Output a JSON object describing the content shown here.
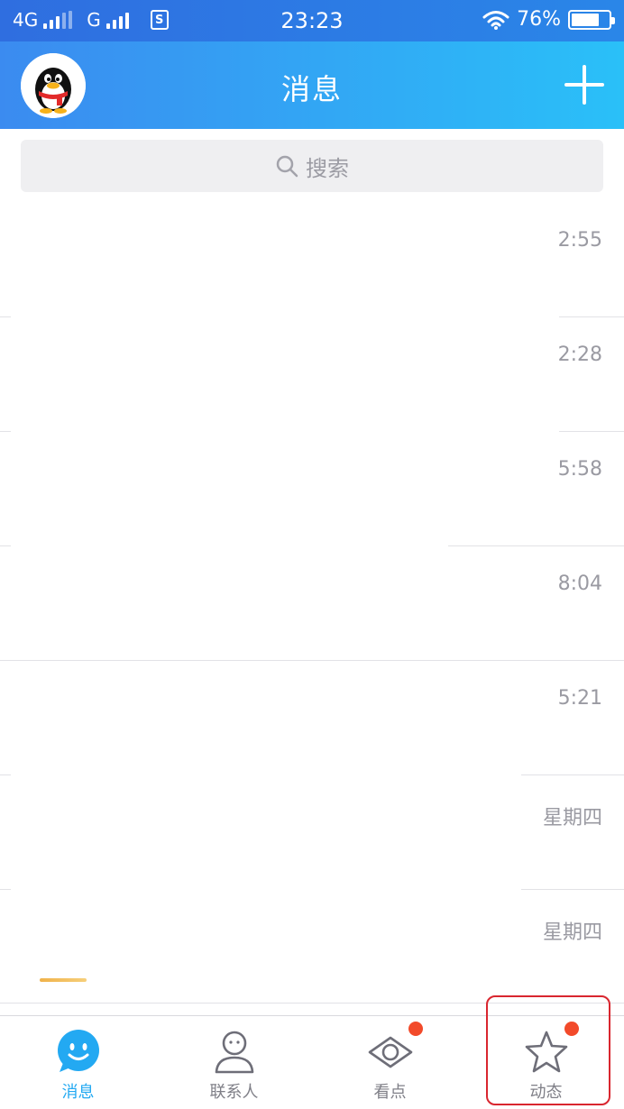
{
  "status_bar": {
    "network_1": "4G",
    "network_2": "G",
    "time": "23:23",
    "battery_percent": "76%",
    "battery_level": 0.76
  },
  "header": {
    "title": "消息"
  },
  "search": {
    "placeholder": "搜索"
  },
  "conversations": [
    {
      "time": "2:55"
    },
    {
      "time": "2:28"
    },
    {
      "time": "5:58"
    },
    {
      "time": "8:04"
    },
    {
      "time": "5:21"
    },
    {
      "time": "星期四"
    },
    {
      "time": "星期四"
    }
  ],
  "tabs": [
    {
      "label": "消息",
      "icon": "message-bubble-icon",
      "active": true
    },
    {
      "label": "联系人",
      "icon": "person-icon",
      "active": false
    },
    {
      "label": "看点",
      "icon": "eye-icon",
      "active": false,
      "badge": true
    },
    {
      "label": "动态",
      "icon": "star-icon",
      "active": false,
      "badge": true
    }
  ],
  "colors": {
    "accent": "#23a9f2",
    "header_start": "#3b8bf0",
    "header_end": "#2ac0f8",
    "badge": "#f24a2a",
    "highlight": "#d9262f"
  }
}
